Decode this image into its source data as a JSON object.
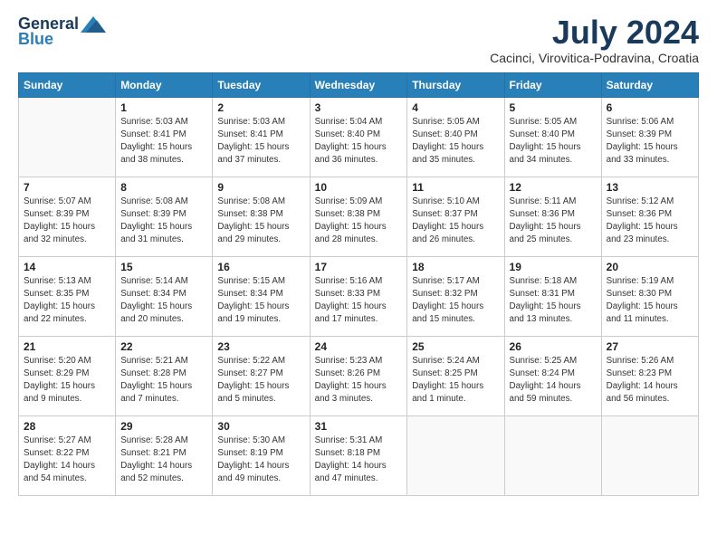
{
  "header": {
    "logo_line1": "General",
    "logo_line2": "Blue",
    "title": "July 2024",
    "location": "Cacinci, Virovitica-Podravina, Croatia"
  },
  "days_of_week": [
    "Sunday",
    "Monday",
    "Tuesday",
    "Wednesday",
    "Thursday",
    "Friday",
    "Saturday"
  ],
  "weeks": [
    [
      {
        "day": "",
        "info": ""
      },
      {
        "day": "1",
        "info": "Sunrise: 5:03 AM\nSunset: 8:41 PM\nDaylight: 15 hours\nand 38 minutes."
      },
      {
        "day": "2",
        "info": "Sunrise: 5:03 AM\nSunset: 8:41 PM\nDaylight: 15 hours\nand 37 minutes."
      },
      {
        "day": "3",
        "info": "Sunrise: 5:04 AM\nSunset: 8:40 PM\nDaylight: 15 hours\nand 36 minutes."
      },
      {
        "day": "4",
        "info": "Sunrise: 5:05 AM\nSunset: 8:40 PM\nDaylight: 15 hours\nand 35 minutes."
      },
      {
        "day": "5",
        "info": "Sunrise: 5:05 AM\nSunset: 8:40 PM\nDaylight: 15 hours\nand 34 minutes."
      },
      {
        "day": "6",
        "info": "Sunrise: 5:06 AM\nSunset: 8:39 PM\nDaylight: 15 hours\nand 33 minutes."
      }
    ],
    [
      {
        "day": "7",
        "info": "Sunrise: 5:07 AM\nSunset: 8:39 PM\nDaylight: 15 hours\nand 32 minutes."
      },
      {
        "day": "8",
        "info": "Sunrise: 5:08 AM\nSunset: 8:39 PM\nDaylight: 15 hours\nand 31 minutes."
      },
      {
        "day": "9",
        "info": "Sunrise: 5:08 AM\nSunset: 8:38 PM\nDaylight: 15 hours\nand 29 minutes."
      },
      {
        "day": "10",
        "info": "Sunrise: 5:09 AM\nSunset: 8:38 PM\nDaylight: 15 hours\nand 28 minutes."
      },
      {
        "day": "11",
        "info": "Sunrise: 5:10 AM\nSunset: 8:37 PM\nDaylight: 15 hours\nand 26 minutes."
      },
      {
        "day": "12",
        "info": "Sunrise: 5:11 AM\nSunset: 8:36 PM\nDaylight: 15 hours\nand 25 minutes."
      },
      {
        "day": "13",
        "info": "Sunrise: 5:12 AM\nSunset: 8:36 PM\nDaylight: 15 hours\nand 23 minutes."
      }
    ],
    [
      {
        "day": "14",
        "info": "Sunrise: 5:13 AM\nSunset: 8:35 PM\nDaylight: 15 hours\nand 22 minutes."
      },
      {
        "day": "15",
        "info": "Sunrise: 5:14 AM\nSunset: 8:34 PM\nDaylight: 15 hours\nand 20 minutes."
      },
      {
        "day": "16",
        "info": "Sunrise: 5:15 AM\nSunset: 8:34 PM\nDaylight: 15 hours\nand 19 minutes."
      },
      {
        "day": "17",
        "info": "Sunrise: 5:16 AM\nSunset: 8:33 PM\nDaylight: 15 hours\nand 17 minutes."
      },
      {
        "day": "18",
        "info": "Sunrise: 5:17 AM\nSunset: 8:32 PM\nDaylight: 15 hours\nand 15 minutes."
      },
      {
        "day": "19",
        "info": "Sunrise: 5:18 AM\nSunset: 8:31 PM\nDaylight: 15 hours\nand 13 minutes."
      },
      {
        "day": "20",
        "info": "Sunrise: 5:19 AM\nSunset: 8:30 PM\nDaylight: 15 hours\nand 11 minutes."
      }
    ],
    [
      {
        "day": "21",
        "info": "Sunrise: 5:20 AM\nSunset: 8:29 PM\nDaylight: 15 hours\nand 9 minutes."
      },
      {
        "day": "22",
        "info": "Sunrise: 5:21 AM\nSunset: 8:28 PM\nDaylight: 15 hours\nand 7 minutes."
      },
      {
        "day": "23",
        "info": "Sunrise: 5:22 AM\nSunset: 8:27 PM\nDaylight: 15 hours\nand 5 minutes."
      },
      {
        "day": "24",
        "info": "Sunrise: 5:23 AM\nSunset: 8:26 PM\nDaylight: 15 hours\nand 3 minutes."
      },
      {
        "day": "25",
        "info": "Sunrise: 5:24 AM\nSunset: 8:25 PM\nDaylight: 15 hours\nand 1 minute."
      },
      {
        "day": "26",
        "info": "Sunrise: 5:25 AM\nSunset: 8:24 PM\nDaylight: 14 hours\nand 59 minutes."
      },
      {
        "day": "27",
        "info": "Sunrise: 5:26 AM\nSunset: 8:23 PM\nDaylight: 14 hours\nand 56 minutes."
      }
    ],
    [
      {
        "day": "28",
        "info": "Sunrise: 5:27 AM\nSunset: 8:22 PM\nDaylight: 14 hours\nand 54 minutes."
      },
      {
        "day": "29",
        "info": "Sunrise: 5:28 AM\nSunset: 8:21 PM\nDaylight: 14 hours\nand 52 minutes."
      },
      {
        "day": "30",
        "info": "Sunrise: 5:30 AM\nSunset: 8:19 PM\nDaylight: 14 hours\nand 49 minutes."
      },
      {
        "day": "31",
        "info": "Sunrise: 5:31 AM\nSunset: 8:18 PM\nDaylight: 14 hours\nand 47 minutes."
      },
      {
        "day": "",
        "info": ""
      },
      {
        "day": "",
        "info": ""
      },
      {
        "day": "",
        "info": ""
      }
    ]
  ]
}
